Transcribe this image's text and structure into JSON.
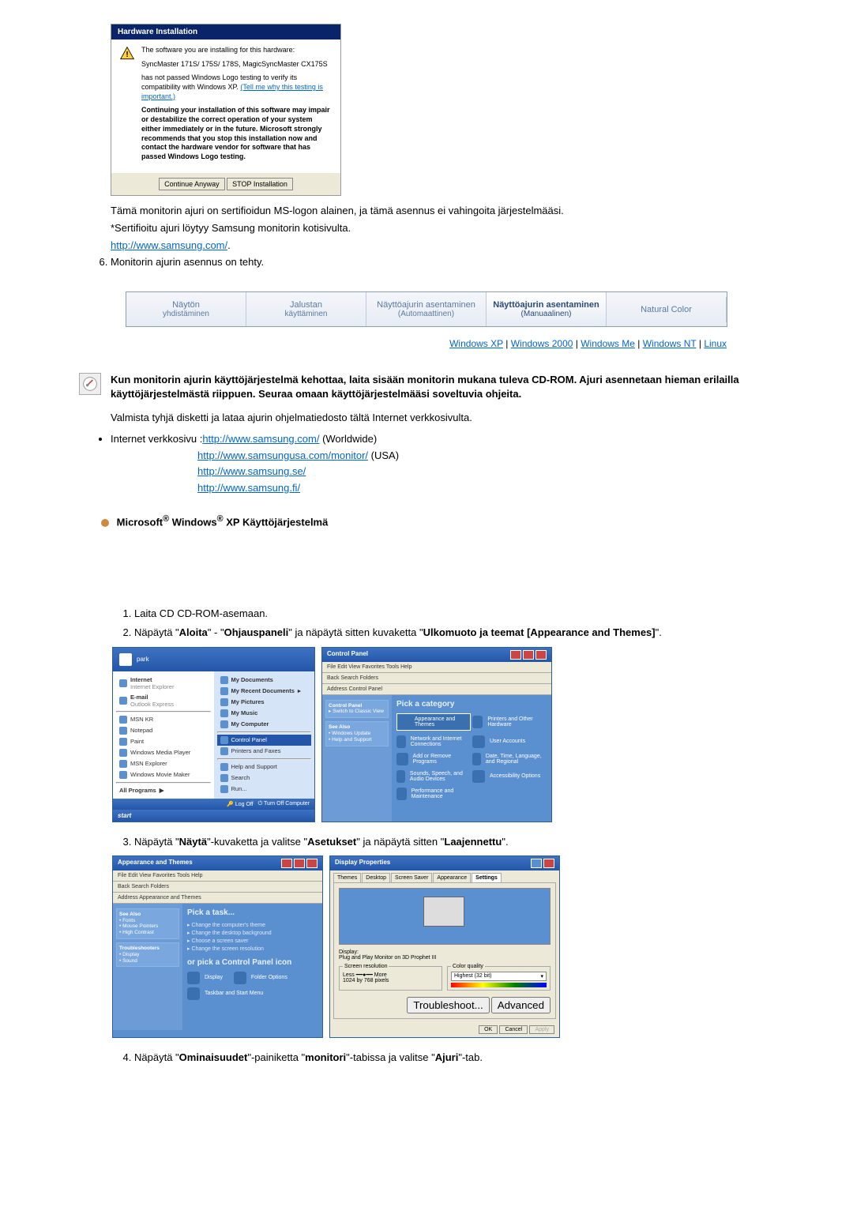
{
  "dialog1": {
    "title": "Hardware Installation",
    "line1": "The software you are installing for this hardware:",
    "line2": "SyncMaster 171S/ 175S/ 178S, MagicSyncMaster CX175S",
    "line3a": "has not passed Windows Logo testing to verify its compatibility with Windows XP. ",
    "line3link": "(Tell me why this testing is important.)",
    "line4": "Continuing your installation of this software may impair or destabilize the correct operation of your system either immediately or in the future. Microsoft strongly recommends that you stop this installation now and contact the hardware vendor for software that has passed Windows Logo testing.",
    "btn_continue": "Continue Anyway",
    "btn_stop": "STOP Installation"
  },
  "para1": "Tämä monitorin ajuri on sertifioidun MS-logon alainen, ja tämä asennus ei vahingoita järjestelmääsi.",
  "para2": "*Sertifioitu ajuri löytyy Samsung monitorin kotisivulta.",
  "link1": "http://www.samsung.com/",
  "step6": "Monitorin ajurin asennus on tehty.",
  "step6_num": "6.",
  "navbar": {
    "t1a": "Näytön",
    "t1b": "yhdistäminen",
    "t2a": "Jalustan",
    "t2b": "käyttäminen",
    "t3a": "Näyttöajurin asentaminen",
    "t3b": "(Automaattinen)",
    "t4a": "Näyttöajurin asentaminen",
    "t4b": "(Manuaalinen)",
    "t5": "Natural Color"
  },
  "oslinks": {
    "xp": "Windows XP",
    "w2k": "Windows 2000",
    "me": "Windows Me",
    "nt": "Windows NT",
    "linux": "Linux"
  },
  "note": "Kun monitorin ajurin käyttöjärjestelmä kehottaa, laita sisään monitorin mukana tuleva CD-ROM. Ajuri asennetaan hieman erilailla käyttöjärjestelmästä riippuen. Seuraa omaan käyttöjärjestelmääsi soveltuvia ohjeita.",
  "note2": "Valmista tyhjä disketti ja lataa ajurin ohjelmatiedosto tältä Internet verkkosivulta.",
  "bullet_label": "Internet verkkosivu :",
  "links": {
    "ww": "http://www.samsung.com/",
    "ww_suffix": " (Worldwide)",
    "usa": "http://www.samsungusa.com/monitor/",
    "usa_suffix": " (USA)",
    "se": "http://www.samsung.se/",
    "fi": "http://www.samsung.fi/"
  },
  "section_title_pre": "Microsoft",
  "section_title_mid": " Windows",
  "section_title_post": " XP Käyttöjärjestelmä",
  "steps": {
    "s1": "Laita CD CD-ROM-asemaan.",
    "s2a": "Näpäytä \"",
    "s2b": "Aloita",
    "s2c": "\" - \"",
    "s2d": "Ohjauspaneli",
    "s2e": "\" ja näpäytä sitten kuvaketta \"",
    "s2f": "Ulkomuoto ja teemat [Appearance and Themes]",
    "s2g": "\".",
    "s3a": "Näpäytä \"",
    "s3b": "Näytä",
    "s3c": "\"-kuvaketta ja valitse \"",
    "s3d": "Asetukset",
    "s3e": "\" ja näpäytä sitten \"",
    "s3f": "Laajennettu",
    "s3g": "\".",
    "s4a": "Näpäytä \"",
    "s4b": "Ominaisuudet",
    "s4c": "\"-painiketta \"",
    "s4d": "monitori",
    "s4e": "\"-tabissa ja valitse \"",
    "s4f": "Ajuri",
    "s4g": "\"-tab."
  },
  "startmenu": {
    "user": "park",
    "left": [
      "Internet",
      "E-mail",
      "MSN KR",
      "Notepad",
      "Paint",
      "Windows Media Player",
      "MSN Explorer",
      "Windows Movie Maker",
      "All Programs"
    ],
    "left_sub": [
      "Internet Explorer",
      "Outlook Express"
    ],
    "right": [
      "My Documents",
      "My Recent Documents",
      "My Pictures",
      "My Music",
      "My Computer",
      "Control Panel",
      "Printers and Faxes",
      "Help and Support",
      "Search",
      "Run..."
    ],
    "bot1": "Log Off",
    "bot2": "Turn Off Computer",
    "start": "start"
  },
  "ctrlpanel": {
    "title": "Control Panel",
    "menu": "File  Edit  View  Favorites  Tools  Help",
    "toolbar": "Back      Search   Folders",
    "address": "Address   Control Panel",
    "side1": "Control Panel",
    "side1a": "Switch to Classic View",
    "side2": "See Also",
    "side2a": "Windows Update",
    "side2b": "Help and Support",
    "pick_cat": "Pick a category",
    "cats": [
      "Appearance and Themes",
      "Network and Internet Connections",
      "Add or Remove Programs",
      "Sounds, Speech, and Audio Devices",
      "Performance and Maintenance",
      "Printers and Other Hardware",
      "User Accounts",
      "Date, Time, Language, and Regional",
      "Accessibility Options"
    ]
  },
  "appthemes": {
    "title": "Appearance and Themes",
    "pick_task": "Pick a task...",
    "tasks": [
      "Change the computer's theme",
      "Change the desktop background",
      "Choose a screen saver",
      "Change the screen resolution"
    ],
    "or_pick": "or pick a Control Panel icon",
    "icons": [
      "Display",
      "Folder Options",
      "Taskbar and Start Menu"
    ]
  },
  "dispprop": {
    "title": "Display Properties",
    "tabs": [
      "Themes",
      "Desktop",
      "Screen Saver",
      "Appearance",
      "Settings"
    ],
    "display_label": "Display:",
    "display_val": "Plug and Play Monitor on 3D Prophet III",
    "res_legend": "Screen resolution",
    "res_less": "Less",
    "res_more": "More",
    "res_val": "1024 by 768 pixels",
    "cq_legend": "Color quality",
    "cq_val": "Highest (32 bit)",
    "btn_ts": "Troubleshoot...",
    "btn_adv": "Advanced",
    "btn_ok": "OK",
    "btn_cancel": "Cancel",
    "btn_apply": "Apply"
  }
}
